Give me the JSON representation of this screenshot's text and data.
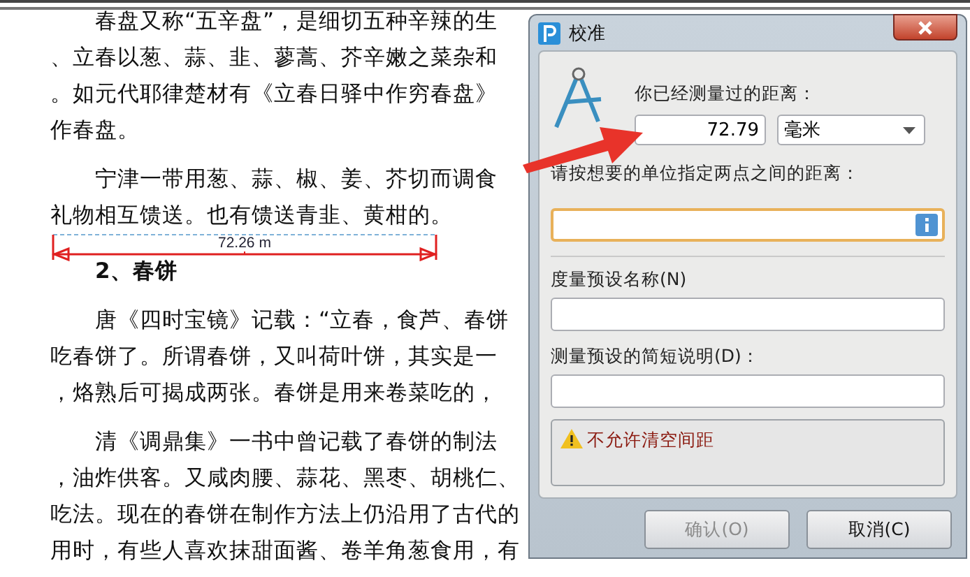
{
  "document": {
    "lines": [
      {
        "kind": "first",
        "text": "春盘又称“五辛盘”，是细切五种辛辣的生"
      },
      {
        "kind": "plain",
        "text": "、立春以葱、蒜、韭、蓼蒿、芥辛嫩之菜杂和"
      },
      {
        "kind": "plain",
        "text": "。如元代耶律楚材有《立春日驿中作穷春盘》"
      },
      {
        "kind": "plain",
        "text": "作春盘。"
      },
      {
        "kind": "first",
        "text": "宁津一带用葱、蒜、椒、姜、芥切而调食"
      },
      {
        "kind": "plain",
        "text": "礼物相互馈送。也有馈送青韭、黄柑的。"
      },
      {
        "kind": "heading",
        "text": "2、春饼"
      },
      {
        "kind": "first",
        "text": "唐《四时宝镜》记载：“立春，食芦、春饼"
      },
      {
        "kind": "plain",
        "text": "吃春饼了。所谓春饼，又叫荷叶饼，其实是一"
      },
      {
        "kind": "plain",
        "text": "，烙熟后可揭成两张。春饼是用来卷菜吃的，"
      },
      {
        "kind": "first",
        "text": "清《调鼎集》一书中曾记载了春饼的制法"
      },
      {
        "kind": "plain",
        "text": "，油炸供客。又咸肉腰、蒜花、黑枣、胡桃仁、"
      },
      {
        "kind": "plain",
        "text": "吃法。现在的春饼在制作方法上仍沿用了古代的"
      },
      {
        "kind": "plain",
        "text": "用时，有些人喜欢抹甜面酱、卷羊角葱食用，有"
      }
    ],
    "measurement": {
      "label": "72.26 m"
    }
  },
  "dialog": {
    "title": "校准",
    "measured_label": "你已经测量过的距离：",
    "measured_value": "72.79",
    "unit": "毫米",
    "distance_label": "请按想要的单位指定两点之间的距离：",
    "distance_field": {
      "focused": true
    },
    "preset_name_label": "度量预设名称(N)",
    "preset_desc_label": "测量预设的简短说明(D)：",
    "warning": "不允许清空间距",
    "buttons": [
      {
        "label": "确认(O)",
        "disabled": true
      },
      {
        "label": "取消(C)",
        "disabled": false
      }
    ]
  }
}
